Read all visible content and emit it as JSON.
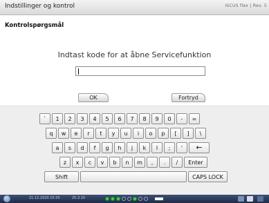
{
  "window": {
    "title": "Indstillinger og kontrol",
    "brand": "ISCUS flex | Rev. 5"
  },
  "dialog": {
    "header": "Kontrolspørgsmål",
    "prompt": "Indtast kode for at åbne Servicefunktion",
    "code_input_value": "",
    "ok_label": "OK",
    "cancel_label": "Fortryd"
  },
  "keyboard": {
    "row1": [
      "`",
      "1",
      "2",
      "3",
      "4",
      "5",
      "6",
      "7",
      "8",
      "9",
      "0",
      "-",
      "="
    ],
    "row2": [
      "q",
      "w",
      "e",
      "r",
      "t",
      "y",
      "u",
      "i",
      "o",
      "p",
      "[",
      "]",
      "\\"
    ],
    "row3": [
      "a",
      "s",
      "d",
      "f",
      "g",
      "h",
      "j",
      "k",
      "l",
      ";",
      "'"
    ],
    "backspace_label": "←",
    "row4": [
      "z",
      "x",
      "c",
      "v",
      "b",
      "n",
      "m",
      ",",
      ".",
      "/"
    ],
    "enter_label": "Enter",
    "shift_label": "Shift",
    "space_label": "",
    "caps_label": "CAPS LOCK"
  },
  "taskbar": {
    "datetime": "21.12.2020 15:35",
    "version": "25.3.10",
    "status_dots": [
      true,
      true,
      true,
      false,
      false,
      true,
      false,
      false
    ],
    "accent": "#38d148"
  }
}
